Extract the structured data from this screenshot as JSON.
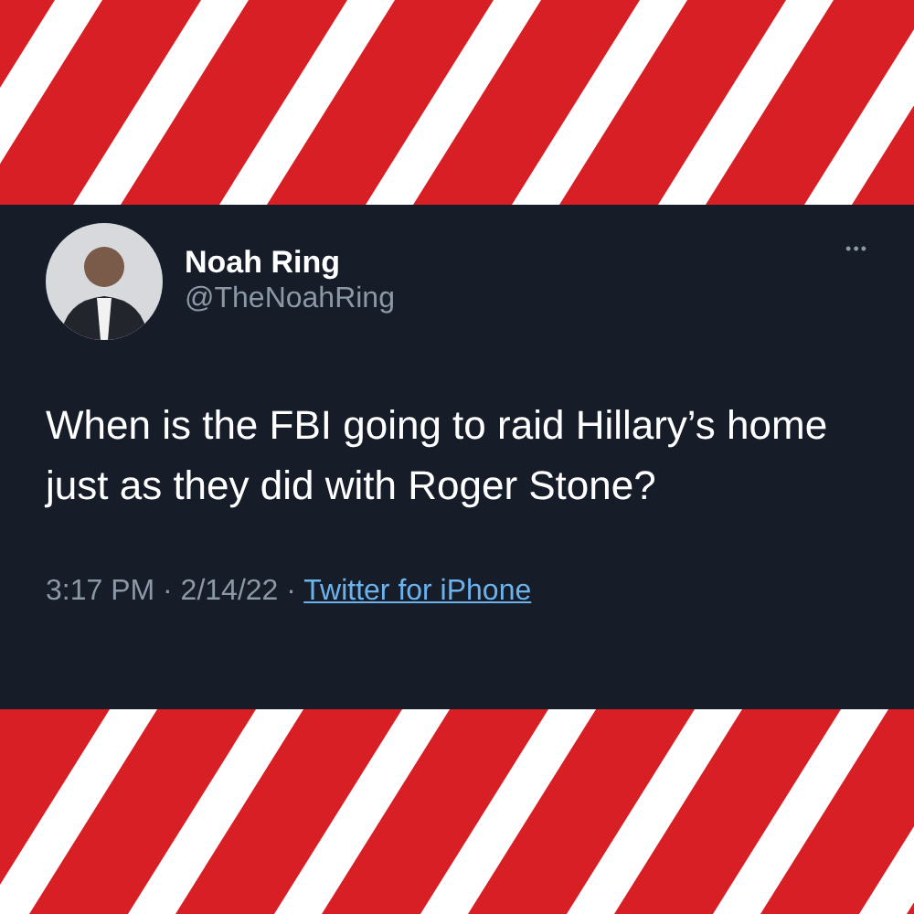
{
  "tweet": {
    "author": {
      "name": "Noah Ring",
      "handle": "@TheNoahRing"
    },
    "more": "•••",
    "text": "When is the FBI going to raid Hillary’s home just as they did with Roger Stone?",
    "timestamp": "3:17 PM · 2/14/22 ·",
    "source": "Twitter for iPhone"
  }
}
